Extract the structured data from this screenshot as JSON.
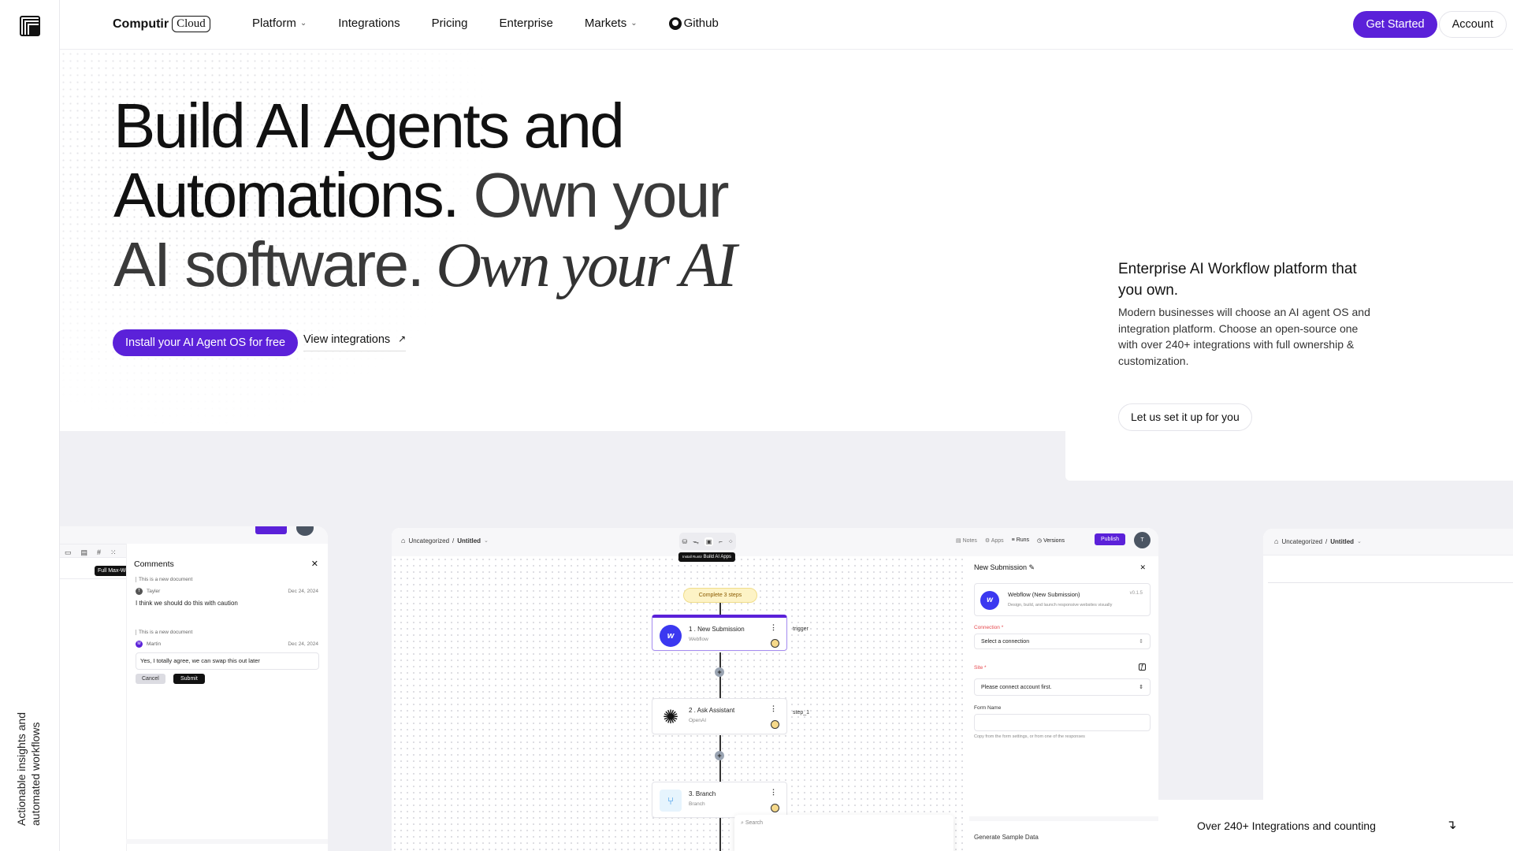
{
  "header": {
    "brand": "Computir",
    "brand_badge": "Cloud",
    "nav": [
      {
        "label": "Platform",
        "dropdown": true
      },
      {
        "label": "Integrations",
        "dropdown": false
      },
      {
        "label": "Pricing",
        "dropdown": false
      },
      {
        "label": "Enterprise",
        "dropdown": false
      },
      {
        "label": "Markets",
        "dropdown": true
      },
      {
        "label": "Github",
        "dropdown": false
      }
    ],
    "get_started": "Get Started",
    "account": "Account"
  },
  "hero": {
    "line1": "Build AI Agents and",
    "line2a": "Automations.",
    "line2b": " Own your",
    "line3a": "AI software.",
    "line3b": " Own your AI",
    "cta_primary": "Install your AI Agent OS for free",
    "cta_secondary": "View integrations",
    "cta_secondary_icon": "↗"
  },
  "side_card": {
    "title": "Enterprise AI Workflow platform that you own.",
    "description": "Modern businesses will choose an AI agent OS and integration platform. Choose an open-source one with over 240+ integrations with full ownership & customization.",
    "button": "Let us set it up for you"
  },
  "rail": {
    "vertical_text": "Actionable insights and automated workflows"
  },
  "comments_panel": {
    "toolbar_tooltip": "Full Max-Width",
    "title": "Comments",
    "threads": [
      {
        "quote": "This is a new document",
        "author": "Tayler",
        "initial": "T",
        "date": "Dec 24, 2024",
        "text": "I think we should do this with caution"
      },
      {
        "quote": "This is a new document",
        "author": "Martin",
        "initial": "M",
        "date": "Dec 24, 2024",
        "reply_value": "Yes, I totally agree, we can swap this out later"
      }
    ],
    "cancel": "Cancel",
    "submit": "Submit"
  },
  "flow_panel": {
    "breadcrumb_root": "Uncategorized",
    "breadcrumb_current": "Untitled",
    "tooltip_prefix": "Install Runtir",
    "tooltip": "Build AI Apps",
    "top_actions": [
      "Notes",
      "Apps",
      "Runs",
      "Versions"
    ],
    "publish": "Publish",
    "avatar_initial": "T",
    "badge": "Complete 3 steps",
    "nodes": [
      {
        "title": "1 . New Submission",
        "subtitle": "Webflow",
        "label": "trigger"
      },
      {
        "title": "2 . Ask Assistant",
        "subtitle": "OpenAI",
        "label": "step_1"
      },
      {
        "title": "3. Branch",
        "subtitle": "Branch",
        "label": ""
      }
    ],
    "search_placeholder": "Search",
    "settings": {
      "title": "New Submission",
      "app_name": "Webflow (New Submission)",
      "app_version": "v0.1.5",
      "app_desc": "Design, build, and launch responsive websites visually",
      "connection_label": "Connection",
      "connection_value": "Select a connection",
      "site_label": "Site",
      "site_value": "Please connect account first.",
      "form_name_label": "Form Name",
      "form_name_value": "",
      "form_name_hint": "Copy from the form settings, or from one of the responses",
      "generate_sample": "Generate Sample Data"
    }
  },
  "third_panel": {
    "breadcrumb_root": "Uncategorized",
    "breadcrumb_current": "Untitled"
  },
  "footer_strip": {
    "text": "Over 240+ Integrations and counting",
    "icon": "↴"
  },
  "colors": {
    "accent": "#5b21d9",
    "webflow": "#3b38f0",
    "warning": "#f6d98a"
  }
}
